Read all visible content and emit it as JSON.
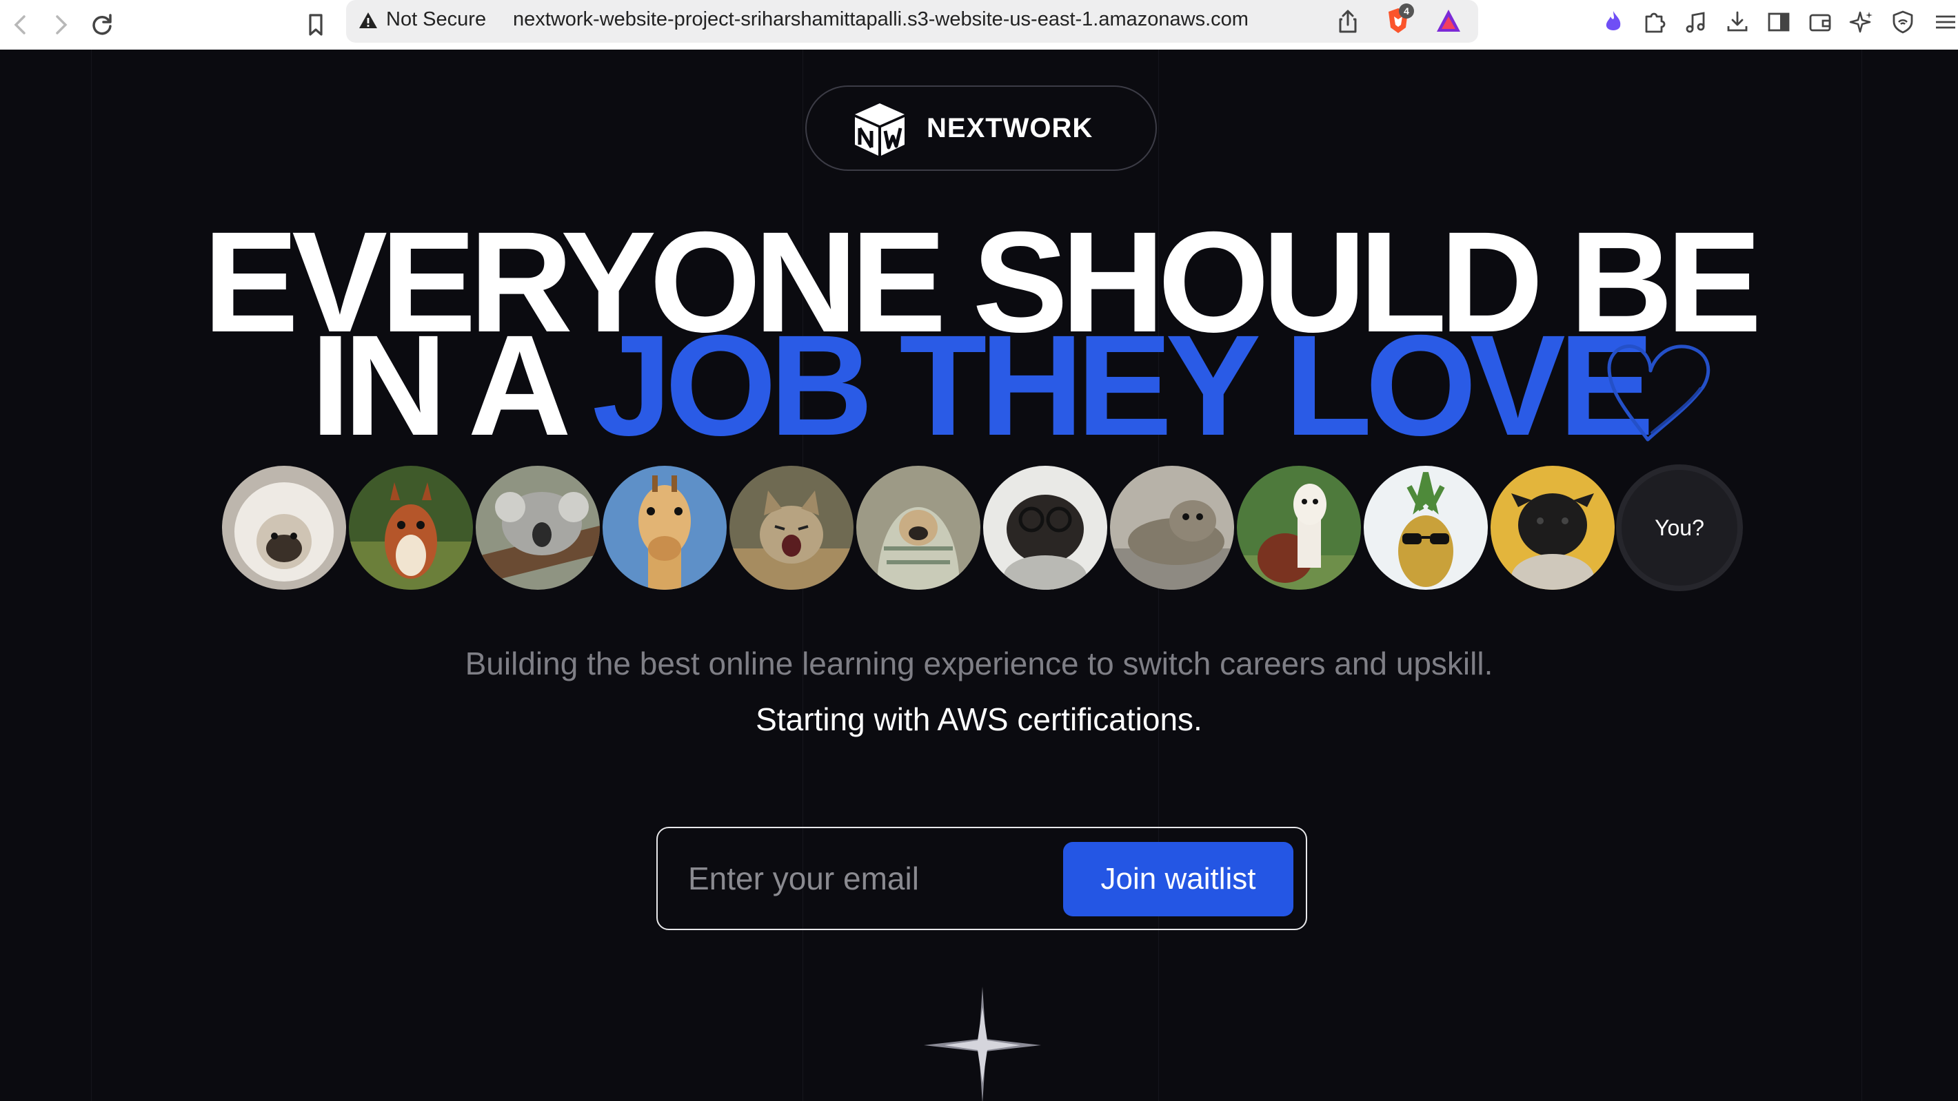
{
  "browser": {
    "security_label": "Not Secure",
    "url": "nextwork-website-project-sriharshamittapalli.s3-website-us-east-1.amazonaws.com",
    "brave_shield_count": "4"
  },
  "logo": {
    "text": "NEXTWORK"
  },
  "headline": {
    "line1": "EVERYONE SHOULD BE",
    "line2_white": "IN A ",
    "line2_blue": "JOB THEY LOVE"
  },
  "avatars": {
    "items": [
      {
        "name": "fluffy-dog-in-fur-hood"
      },
      {
        "name": "red-squirrel"
      },
      {
        "name": "sleeping-koala"
      },
      {
        "name": "giraffe"
      },
      {
        "name": "yawning-kitten"
      },
      {
        "name": "pug-in-blanket"
      },
      {
        "name": "pug-with-glasses"
      },
      {
        "name": "seal"
      },
      {
        "name": "alpaca"
      },
      {
        "name": "pineapple-with-sunglasses"
      },
      {
        "name": "black-pug-on-yellow"
      }
    ],
    "you_label": "You?"
  },
  "subtitle": {
    "line1": "Building the best online learning experience to switch careers and upskill.",
    "line2": "Starting with AWS certifications."
  },
  "waitlist": {
    "email_placeholder": "Enter your email",
    "button_label": "Join waitlist"
  },
  "colors": {
    "background": "#0b0b10",
    "accent_blue": "#2a5be6",
    "button_blue": "#2456e4"
  }
}
